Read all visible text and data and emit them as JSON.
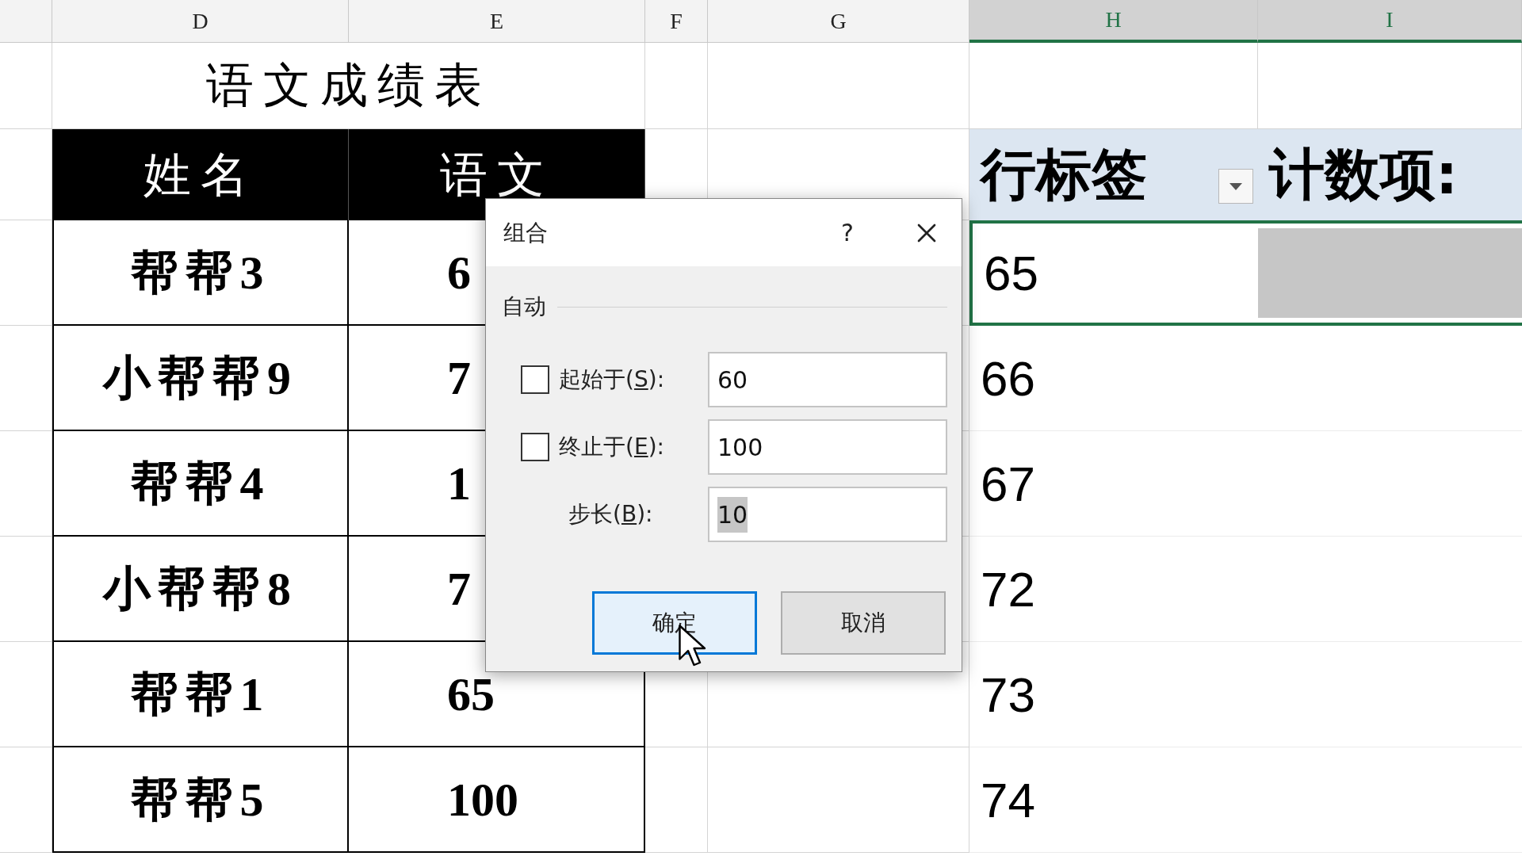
{
  "column_headers": [
    {
      "label": "D",
      "selected": false
    },
    {
      "label": "E",
      "selected": false
    },
    {
      "label": "F",
      "selected": false
    },
    {
      "label": "G",
      "selected": false
    },
    {
      "label": "H",
      "selected": true
    },
    {
      "label": "I",
      "selected": true
    }
  ],
  "title": "语文成绩表",
  "table": {
    "columns": [
      "姓名",
      "语文"
    ],
    "rows": [
      [
        "帮帮3",
        "6"
      ],
      [
        "小帮帮9",
        "7"
      ],
      [
        "帮帮4",
        "1"
      ],
      [
        "小帮帮8",
        "7"
      ],
      [
        "帮帮1",
        "65"
      ],
      [
        "帮帮5",
        "100"
      ]
    ]
  },
  "pivot": {
    "columns": [
      {
        "label": "行标签",
        "filter": true
      },
      {
        "label": "计数项:"
      }
    ],
    "rows": [
      {
        "label": "65",
        "selected": true
      },
      {
        "label": "66",
        "selected": false
      },
      {
        "label": "67",
        "selected": false
      },
      {
        "label": "72",
        "selected": false
      },
      {
        "label": "73",
        "selected": false
      },
      {
        "label": "74",
        "selected": false
      }
    ]
  },
  "dialog": {
    "title": "组合",
    "help": "?",
    "group_label": "自动",
    "fields": [
      {
        "kind": "checkbox",
        "before": "起始于(",
        "key": "S",
        "after": "):",
        "checked": false,
        "value": "60",
        "highlighted": false
      },
      {
        "kind": "checkbox",
        "before": "终止于(",
        "key": "E",
        "after": "):",
        "checked": false,
        "value": "100",
        "highlighted": false
      },
      {
        "kind": "plain",
        "before": "步长(",
        "key": "B",
        "after": "):",
        "value": "10",
        "highlighted": true
      }
    ],
    "buttons": [
      {
        "label": "确定",
        "default": true
      },
      {
        "label": "取消",
        "default": false
      }
    ]
  }
}
